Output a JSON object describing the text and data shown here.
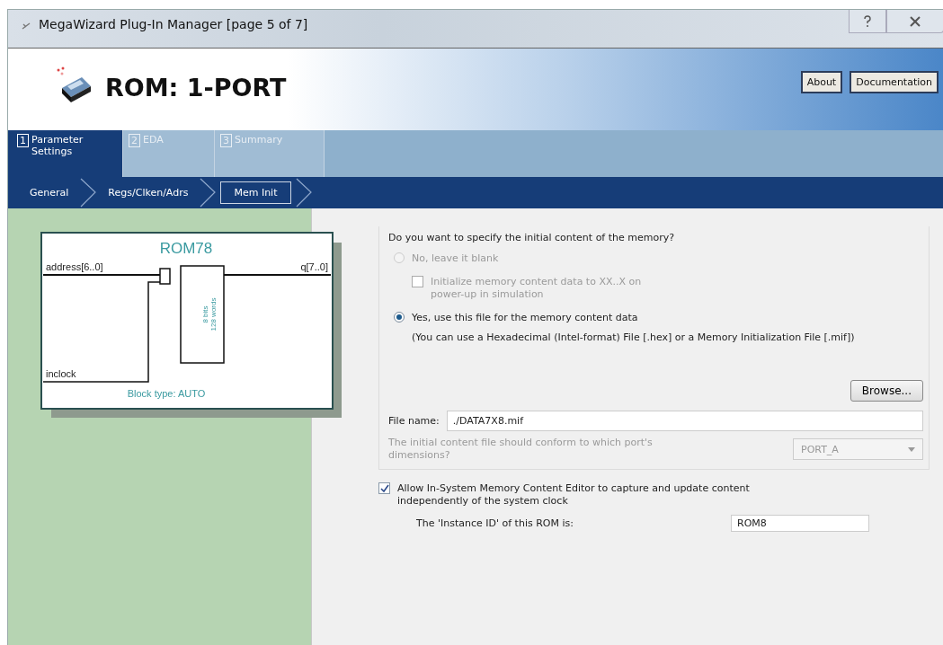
{
  "window": {
    "title": "MegaWizard Plug-In Manager [page 5 of 7]"
  },
  "header": {
    "title": "ROM: 1-PORT",
    "buttons": [
      "About",
      "Documentation"
    ]
  },
  "tabs": [
    {
      "number": "1",
      "label": "Parameter Settings",
      "selected": true
    },
    {
      "number": "2",
      "label": "EDA",
      "selected": false
    },
    {
      "number": "3",
      "label": "Summary",
      "selected": false
    }
  ],
  "steps": [
    {
      "label": "General",
      "selected": false
    },
    {
      "label": "Regs/Clken/Adrs",
      "selected": false
    },
    {
      "label": "Mem Init",
      "selected": true
    }
  ],
  "diagram": {
    "name": "ROM78",
    "input": "address[6..0]",
    "output": "q[7..0]",
    "clock": "inclock",
    "size_lines": [
      "8 bits",
      "128 words"
    ],
    "block_type": "Block type: AUTO"
  },
  "memory_init": {
    "question": "Do you want to specify the initial content of the memory?",
    "options": [
      {
        "label": "No, leave it blank",
        "selected": false,
        "disabled": true
      },
      {
        "label": "Yes, use this file for the memory content data",
        "selected": true,
        "disabled": false
      }
    ],
    "sub_checkbox": {
      "label": "Initialize memory content data to XX..X on power-up in simulation",
      "checked": false,
      "disabled": true
    },
    "note": "(You can use a Hexadecimal (Intel-format) File [.hex] or a Memory Initialization File [.mif])",
    "browse": "Browse...",
    "file_label": "File name:",
    "file_value": "./DATA7X8.mif",
    "port_question": "The initial content file should conform to which port's dimensions?",
    "port_value": "PORT_A"
  },
  "editor": {
    "label": "Allow In-System Memory Content Editor to capture and update content independently of the system clock",
    "checked": true
  },
  "instance": {
    "label": "The 'Instance ID' of this ROM is:",
    "value": "ROM8"
  }
}
